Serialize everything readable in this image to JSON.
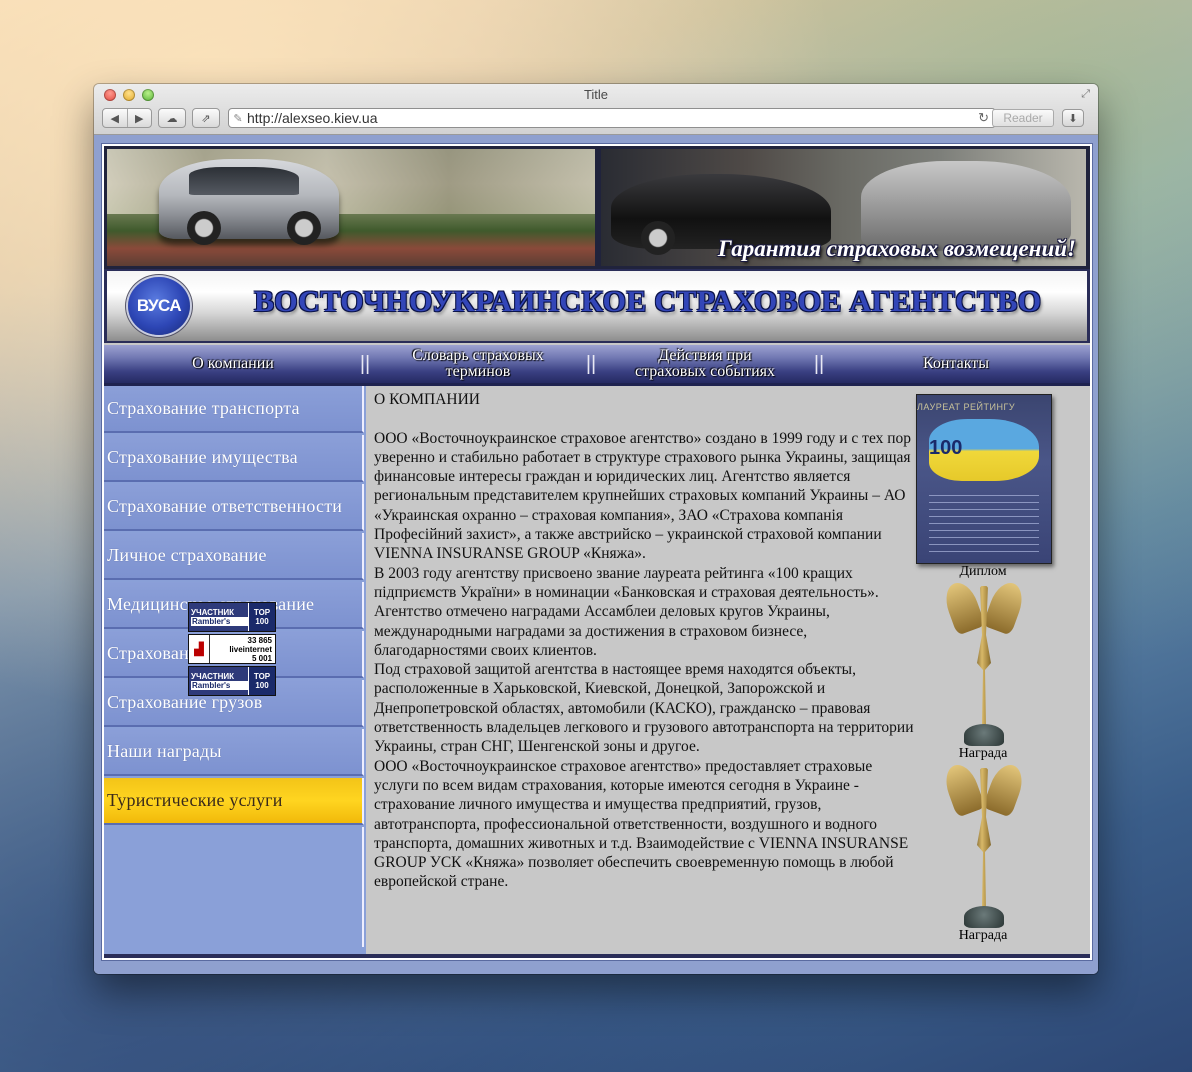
{
  "browser": {
    "title": "Title",
    "url": "http://alexseo.kiev.ua",
    "reader_label": "Reader"
  },
  "banner": {
    "tagline": "Гарантия страховых возмещений!"
  },
  "logo": {
    "badge": "ВУСА",
    "company_name": "ВОСТОЧНОУКРАИНСКОЕ СТРАХОВОЕ АГЕНТСТВО"
  },
  "topnav": {
    "items": [
      {
        "line1": "О компании",
        "line2": ""
      },
      {
        "line1": "Словарь страховых",
        "line2": "терминов"
      },
      {
        "line1": "Действия при",
        "line2": "страховых событиях"
      },
      {
        "line1": "Контакты",
        "line2": ""
      }
    ],
    "divider": "||"
  },
  "sidebar": {
    "items": [
      "Страхование транспорта",
      "Страхование имущества",
      "Страхование ответственности",
      "Личное страхование",
      "Медицинское страхование",
      "Страхование жизни",
      "Страхование грузов",
      "Наши награды",
      "Туристические услуги"
    ],
    "active_index": 8
  },
  "counters": {
    "rambler1": {
      "top": "УЧАСТНИК",
      "bottom": "Rambler's",
      "badge1": "TOP",
      "badge2": "100"
    },
    "liveinternet": {
      "name": "liveinternet",
      "n1": "33 865",
      "n2": "5 001"
    },
    "rambler2": {
      "top": "УЧАСТНИК",
      "bottom": "Rambler's",
      "badge1": "TOP",
      "badge2": "100"
    }
  },
  "content": {
    "heading": "О КОМПАНИИ",
    "paragraphs": [
      "ООО «Восточноукраинское страховое агентство» создано в 1999 году и с тех пор уверенно и стабильно работает в структуре  страхового рынка Украины, защищая финансовые интересы граждан и юридических лиц. Агентство является региональным представителем крупнейших страховых компаний Украины – АО «Украинская охранно – страховая компания», ЗАО «Страхова компанія Професійний захист», а также австрийско – украинской страховой компании VIENNA INSURANSE GROUP «Княжа».",
      "В 2003 году агентству присвоено звание лауреата рейтинга «100 кращих підприємств України» в номинации «Банковская и страховая деятельность». Агентство отмечено наградами Ассамблеи деловых кругов Украины, международными наградами за достижения в страховом бизнесе, благодарностями своих клиентов.",
      "Под страховой защитой агентства в настоящее время находятся объекты, расположенные в Харьковской, Киевской, Донецкой, Запорожской и Днепропетровской областях, автомобили (КАСКО), гражданско – правовая ответственность владельцев легкового и грузового автотранспорта на территории Украины, стран СНГ, Шенгенской зоны и другое.",
      "ООО «Восточноукраинское страховое агентство» предоставляет страховые услуги по всем видам страхования, которые имеются сегодня в Украине -  страхование личного имущества и имущества предприятий, грузов, автотранспорта, профессиональной ответственности, воздушного и водного транспорта, домашних животных и т.д. Взаимодействие с VIENNA INSURANSE GROUP УСК «Княжа» позволяет обеспечить своевременную помощь в любой европейской стране."
    ]
  },
  "awards": {
    "diploma_title": "ЛАУРЕАТ РЕЙТИНГУ",
    "diploma_number": "100",
    "captions": [
      "Диплом",
      "Награда",
      "Награда"
    ]
  }
}
